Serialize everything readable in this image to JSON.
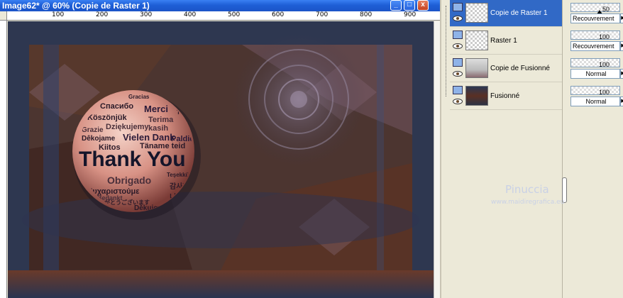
{
  "window": {
    "title": "Image62* @ 60% (Copie de Raster 1)",
    "buttons": {
      "minimize": "_",
      "maximize": "□",
      "close": "x"
    }
  },
  "ruler": {
    "labels": [
      "100",
      "200",
      "300",
      "400",
      "500",
      "600",
      "700",
      "800",
      "900"
    ]
  },
  "artwork": {
    "headline": "Thank You",
    "words": [
      "Gracias",
      "Спасибо",
      "Merci",
      "Takk",
      "Köszönjük",
      "Terima kasih",
      "Grazie",
      "Dziękujemy",
      "Dêkojame",
      "Vielen Dank",
      "Paldies",
      "Kiitos",
      "Täname teid",
      "Obrigado",
      "Teşekkür Ederiz",
      "감사합니다",
      "Ευχαριστούμε",
      "ありがとうございます",
      "Děkujeme vám",
      "Bedankt",
      "Tack"
    ],
    "watermark": {
      "name": "Pinuccia",
      "url": "www.maidiregrafica.eu"
    }
  },
  "layers": [
    {
      "name": "Copie de Raster 1",
      "selected": true,
      "thumb": "transparent"
    },
    {
      "name": "Raster 1",
      "selected": false,
      "thumb": "transparent"
    },
    {
      "name": "Copie de Fusionné",
      "selected": false,
      "thumb": "soft"
    },
    {
      "name": "Fusionné",
      "selected": false,
      "thumb": "dark"
    }
  ],
  "blend_panel": [
    {
      "opacity": "50",
      "mode": "Recouvrement"
    },
    {
      "opacity": "100",
      "mode": "Recouvrement"
    },
    {
      "opacity": "100",
      "mode": "Normal"
    },
    {
      "opacity": "100",
      "mode": "Normal"
    }
  ],
  "colors": {
    "selection": "#3169c6",
    "titlebar": "#1e5fd6"
  }
}
